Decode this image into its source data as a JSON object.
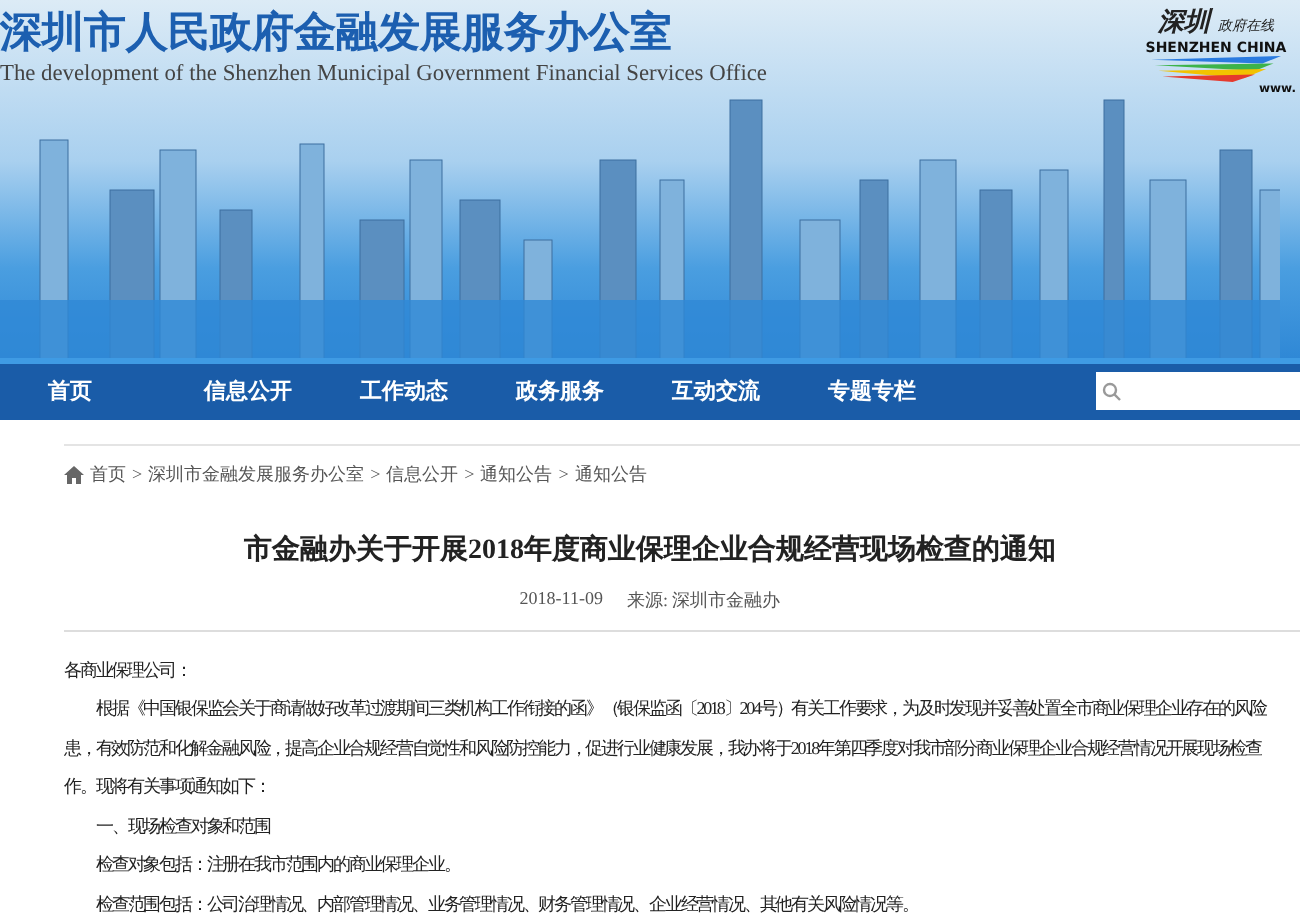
{
  "header": {
    "title": "深圳市人民政府金融发展服务办公室",
    "subtitle": "The development of the Shenzhen Municipal Government Financial Services Office",
    "logo": {
      "calligraphy": "深圳",
      "tagline": "政府在线",
      "name": "SHENZHEN CHINA",
      "url": "www."
    }
  },
  "nav": {
    "items": [
      {
        "label": "首页"
      },
      {
        "label": "信息公开"
      },
      {
        "label": "工作动态"
      },
      {
        "label": "政务服务"
      },
      {
        "label": "互动交流"
      },
      {
        "label": "专题专栏"
      }
    ]
  },
  "breadcrumb": {
    "separator": ">",
    "items": [
      "首页",
      "深圳市金融发展服务办公室",
      "信息公开",
      "通知公告",
      "通知公告"
    ]
  },
  "article": {
    "title": "市金融办关于开展2018年度商业保理企业合规经营现场检查的通知",
    "date": "2018-11-09",
    "source": "来源: 深圳市金融办",
    "paragraphs": [
      {
        "kind": "plain",
        "lines": [
          "各商业保理公司："
        ]
      },
      {
        "kind": "indent",
        "lines": [
          "根据《中国银保监会关于商请做好改革过渡期间三类机构工作衔接的函》（银保监函〔2018〕204号）有关工作要求，为及时发现并妥善处置全市商业保理企业存在的风险",
          "患，有效防范和化解金融风险，提高企业合规经营自觉性和风险防控能力，促进行业健康发展，我办将于2018年第四季度对我市部分商业保理企业合规经营情况开展现场检查",
          "作。现将有关事项通知如下："
        ]
      },
      {
        "kind": "indent",
        "lines": [
          "一、现场检查对象和范围"
        ]
      },
      {
        "kind": "indent",
        "lines": [
          "检查对象包括：注册在我市范围内的商业保理企业。"
        ]
      },
      {
        "kind": "indent",
        "lines": [
          "检查范围包括：公司治理情况、内部管理情况、业务管理情况、财务管理情况、企业经营情况、其他有关风险情况等。"
        ]
      }
    ]
  }
}
